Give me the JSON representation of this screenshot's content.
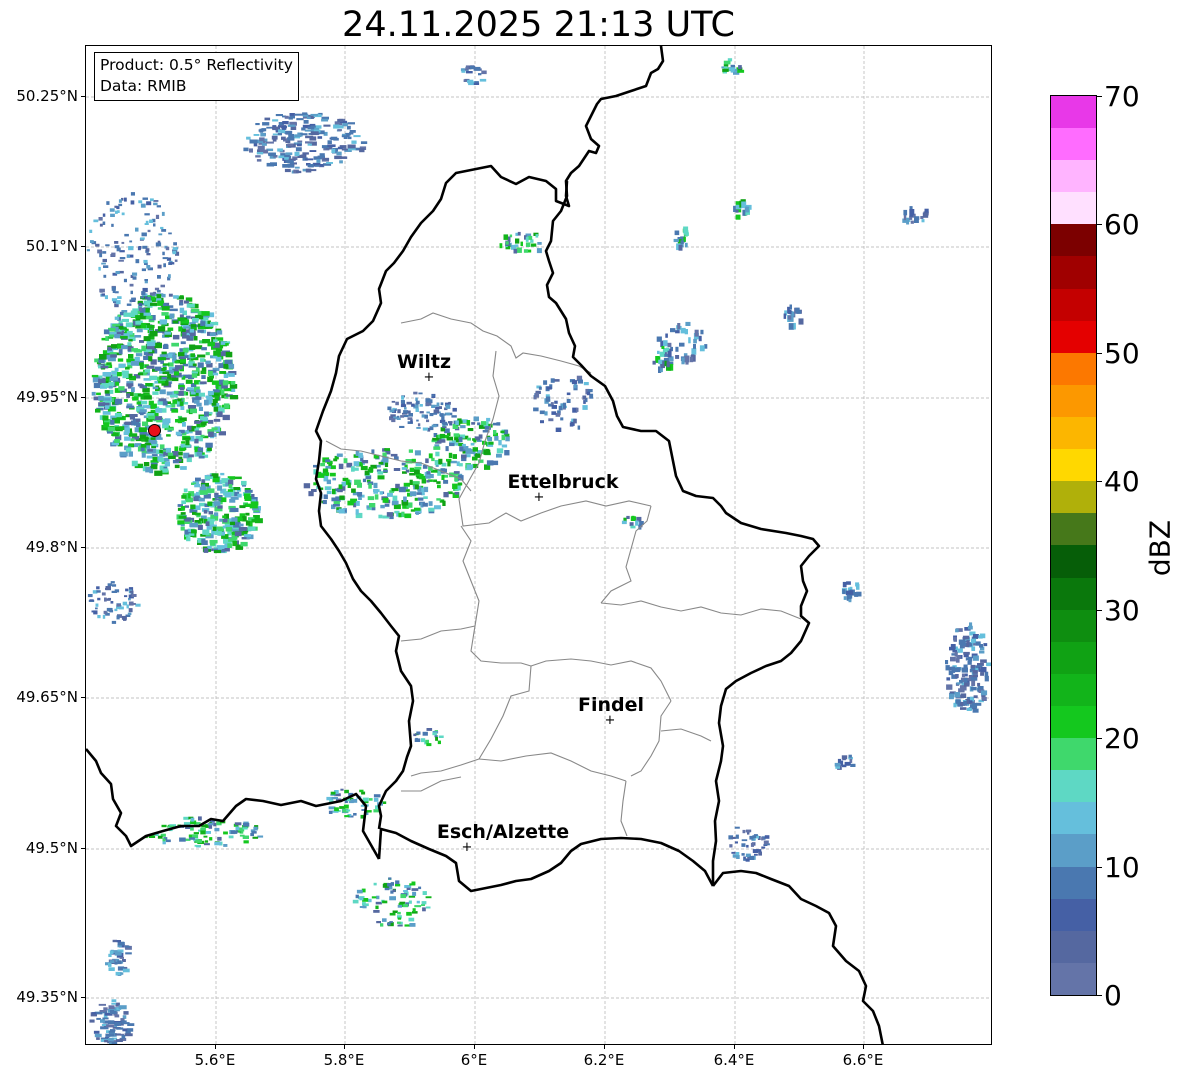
{
  "title": "24.11.2025 21:13 UTC",
  "info": {
    "product": "Product: 0.5° Reflectivity",
    "data": "Data: RMIB"
  },
  "latitude_labels": [
    "50.25°N",
    "50.1°N",
    "49.95°N",
    "49.8°N",
    "49.65°N",
    "49.5°N",
    "49.35°N"
  ],
  "longitude_labels": [
    "5.6°E",
    "5.8°E",
    "6°E",
    "6.2°E",
    "6.4°E",
    "6.6°E"
  ],
  "cities": [
    {
      "name": "Wiltz"
    },
    {
      "name": "Ettelbruck"
    },
    {
      "name": "Findel"
    },
    {
      "name": "Esch/Alzette"
    }
  ],
  "marker_symbol": "+",
  "colorbar": {
    "label": "dBZ",
    "ticks": [
      "0",
      "10",
      "20",
      "30",
      "40",
      "50",
      "60",
      "70"
    ],
    "colors": [
      "#6474a8",
      "#5568a0",
      "#4560a5",
      "#4a78b0",
      "#5b9ec8",
      "#65bfdc",
      "#5ed8c4",
      "#3fd86c",
      "#14c81e",
      "#12b41a",
      "#10a214",
      "#0e8e10",
      "#0a780c",
      "#065e08",
      "#46781a",
      "#b0b00a",
      "#ffd800",
      "#fcb600",
      "#fc9800",
      "#fc7800",
      "#e40000",
      "#c40000",
      "#a00000",
      "#7c0000",
      "#ffe0ff",
      "#ffb4ff",
      "#ff6cff",
      "#e838e8"
    ]
  },
  "map_style": {
    "border_color": "#000000",
    "canton_color": "#888888",
    "grid_color": "#b0b0b0",
    "radar_site_color": "#e8101a"
  }
}
